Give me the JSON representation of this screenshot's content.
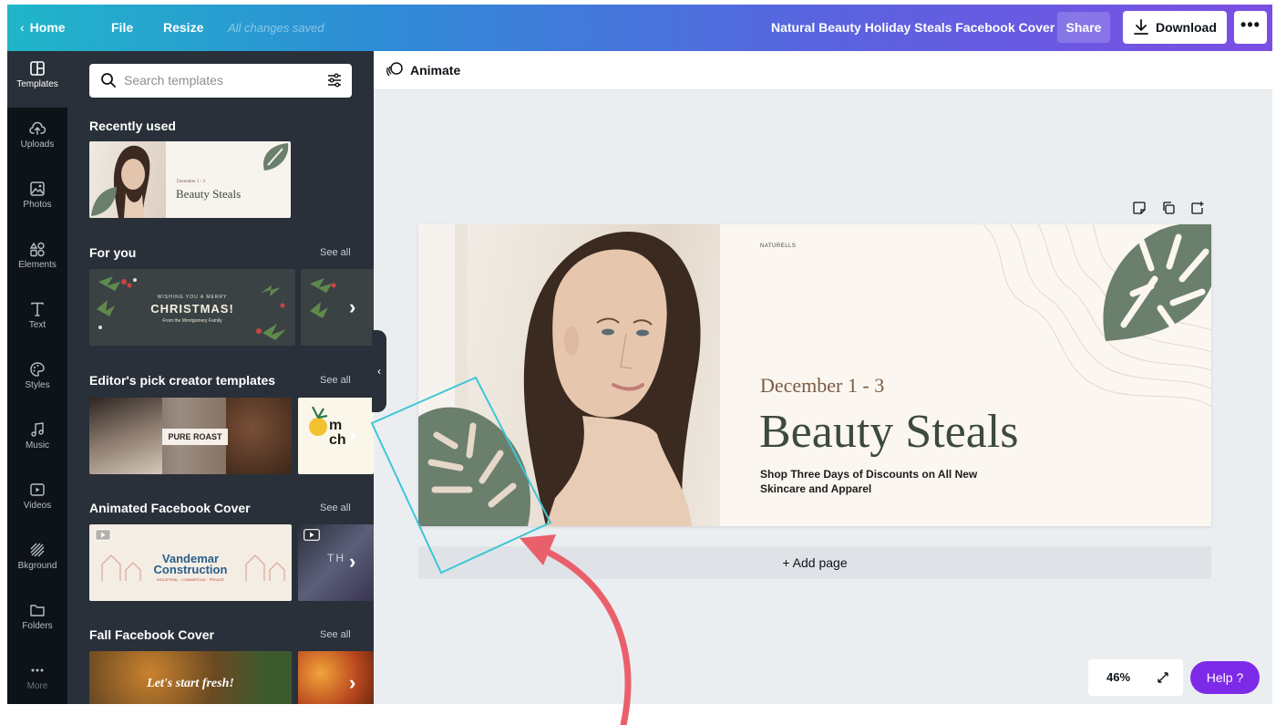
{
  "header": {
    "home": "Home",
    "file": "File",
    "resize": "Resize",
    "saved_status": "All changes saved",
    "document_title": "Natural Beauty Holiday Steals Facebook Cover",
    "share": "Share",
    "download": "Download",
    "more": "•••"
  },
  "rail": {
    "items": [
      {
        "label": "Templates",
        "icon": "templates-icon"
      },
      {
        "label": "Uploads",
        "icon": "uploads-icon"
      },
      {
        "label": "Photos",
        "icon": "photos-icon"
      },
      {
        "label": "Elements",
        "icon": "elements-icon"
      },
      {
        "label": "Text",
        "icon": "text-icon"
      },
      {
        "label": "Styles",
        "icon": "styles-icon"
      },
      {
        "label": "Music",
        "icon": "music-icon"
      },
      {
        "label": "Videos",
        "icon": "videos-icon"
      },
      {
        "label": "Bkground",
        "icon": "background-icon"
      },
      {
        "label": "Folders",
        "icon": "folders-icon"
      },
      {
        "label": "More",
        "icon": "more-icon"
      }
    ]
  },
  "panel": {
    "search_placeholder": "Search templates",
    "recently_used": "Recently used",
    "for_you": "For you",
    "editors_pick": "Editor's pick creator templates",
    "animated_cover": "Animated Facebook Cover",
    "fall_cover": "Fall Facebook Cover",
    "see_all": "See all",
    "thumbs": {
      "recent_date": "December 1 - 3",
      "recent_title": "Beauty Steals",
      "xmas_top": "WISHING YOU A MERRY",
      "xmas_title": "CHRISTMAS!",
      "xmas_sub": "From the Montgomery Family",
      "roast": "PURE ROAST",
      "partial_m": "m",
      "partial_ch": "ch",
      "vandemar_1": "Vandemar",
      "vandemar_2": "Construction",
      "vandemar_sub": "INDUSTRIAL · COMMERCIAL · PRIVATE",
      "partial_th": "TH",
      "fresh": "Let's start fresh!"
    }
  },
  "toolbar": {
    "animate": "Animate"
  },
  "design": {
    "brand": "NATURELLS",
    "date": "December 1 - 3",
    "headline": "Beauty Steals",
    "subtext": "Shop Three Days of Discounts on All New Skincare and Apparel"
  },
  "canvas": {
    "add_page": "+ Add page",
    "zoom": "46%",
    "help": "Help ?"
  },
  "colors": {
    "accent_purple": "#7d2ae8",
    "panel_bg": "#293039",
    "rail_bg": "#0e1318",
    "leaf_green": "#6b7f6d",
    "selection_cyan": "#3ec6d6",
    "annotation_red": "#e9606b"
  }
}
